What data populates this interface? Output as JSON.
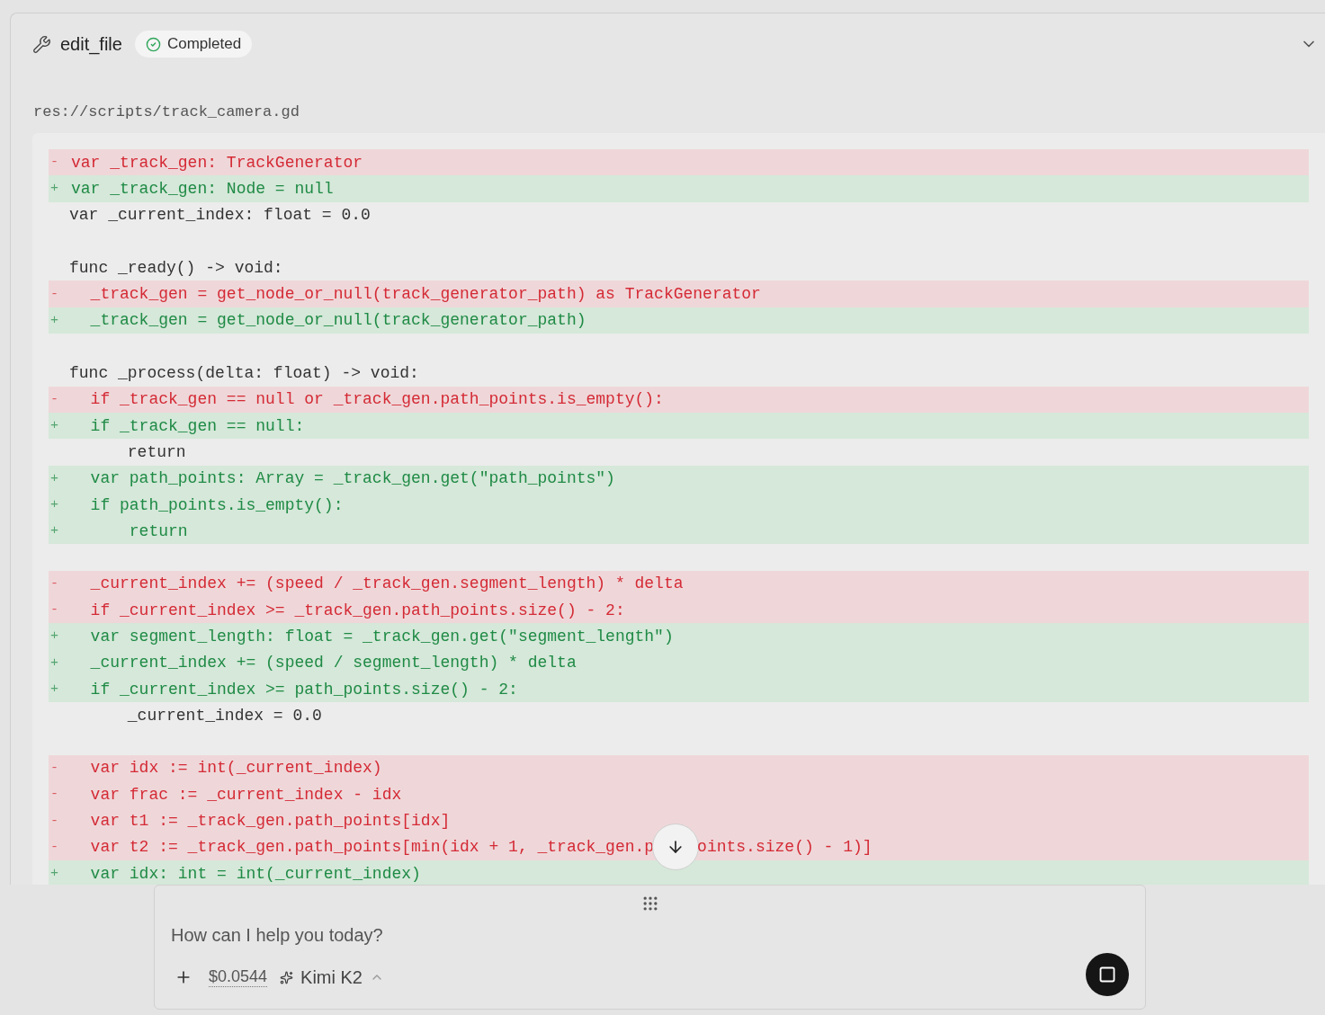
{
  "tool_call": {
    "name": "edit_file",
    "status": "Completed",
    "expanded": true,
    "file_path": "res://scripts/track_camera.gd",
    "diff": [
      {
        "kind": "del",
        "marker": "-",
        "text": "var _track_gen: TrackGenerator"
      },
      {
        "kind": "add",
        "marker": "+",
        "text": "var _track_gen: Node = null"
      },
      {
        "kind": "ctx",
        "text": "var _current_index: float = 0.0"
      },
      {
        "kind": "blank"
      },
      {
        "kind": "ctx",
        "text": "func _ready() -> void:"
      },
      {
        "kind": "del",
        "marker": "-",
        "text": "  _track_gen = get_node_or_null(track_generator_path) as TrackGenerator"
      },
      {
        "kind": "add",
        "marker": "+",
        "text": "  _track_gen = get_node_or_null(track_generator_path)"
      },
      {
        "kind": "blank"
      },
      {
        "kind": "ctx",
        "text": "func _process(delta: float) -> void:"
      },
      {
        "kind": "del",
        "marker": "-",
        "text": "  if _track_gen == null or _track_gen.path_points.is_empty():"
      },
      {
        "kind": "add",
        "marker": "+",
        "text": "  if _track_gen == null:"
      },
      {
        "kind": "ctx",
        "text": "      return"
      },
      {
        "kind": "add",
        "marker": "+",
        "text": "  var path_points: Array = _track_gen.get(\"path_points\")"
      },
      {
        "kind": "add",
        "marker": "+",
        "text": "  if path_points.is_empty():"
      },
      {
        "kind": "add",
        "marker": "+",
        "text": "      return"
      },
      {
        "kind": "blank"
      },
      {
        "kind": "del",
        "marker": "-",
        "text": "  _current_index += (speed / _track_gen.segment_length) * delta"
      },
      {
        "kind": "del",
        "marker": "-",
        "text": "  if _current_index >= _track_gen.path_points.size() - 2:"
      },
      {
        "kind": "add",
        "marker": "+",
        "text": "  var segment_length: float = _track_gen.get(\"segment_length\")"
      },
      {
        "kind": "add",
        "marker": "+",
        "text": "  _current_index += (speed / segment_length) * delta"
      },
      {
        "kind": "add",
        "marker": "+",
        "text": "  if _current_index >= path_points.size() - 2:"
      },
      {
        "kind": "ctx",
        "text": "      _current_index = 0.0"
      },
      {
        "kind": "blank"
      },
      {
        "kind": "del",
        "marker": "-",
        "text": "  var idx := int(_current_index)"
      },
      {
        "kind": "del",
        "marker": "-",
        "text": "  var frac := _current_index - idx"
      },
      {
        "kind": "del",
        "marker": "-",
        "text": "  var t1 := _track_gen.path_points[idx]"
      },
      {
        "kind": "del",
        "marker": "-",
        "text": "  var t2 := _track_gen.path_points[min(idx + 1, _track_gen.p",
        "tail": "oints.size() - 1)]"
      },
      {
        "kind": "add",
        "marker": "+",
        "text": "  var idx: int = int(_current_index)"
      }
    ]
  },
  "composer": {
    "placeholder": "How can I help you today?",
    "cost": "$0.0544",
    "model": "Kimi K2"
  }
}
